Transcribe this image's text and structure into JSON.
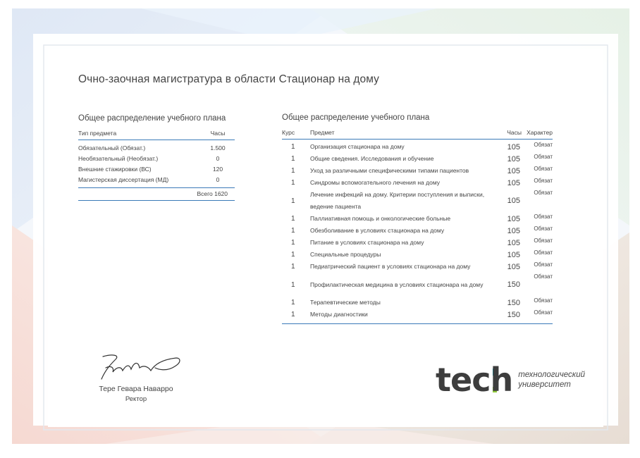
{
  "title": "Очно-заочная магистратура в области Стационар на дому",
  "summary_table": {
    "heading": "Общее распределение учебного плана",
    "col_type": "Тип предмета",
    "col_hours": "Часы",
    "rows": [
      {
        "type": "Обязательный (Обязат.)",
        "hours": "1.500"
      },
      {
        "type": "Необязательный (Необязат.)",
        "hours": "0"
      },
      {
        "type": "Внешние стажировки (ВС)",
        "hours": "120"
      },
      {
        "type": "Магистерская диссертация (МД)",
        "hours": "0"
      }
    ],
    "total": "Всего 1620"
  },
  "detail_table": {
    "heading": "Общее распределение учебного плана",
    "col_course": "Курс",
    "col_subject": "Предмет",
    "col_hours": "Часы",
    "col_type": "Характер",
    "rows": [
      {
        "course": "1",
        "subject": "Организация стационара на дому",
        "hours": "105",
        "type": "Обязат"
      },
      {
        "course": "1",
        "subject": "Общие сведения. Исследования и обучение",
        "hours": "105",
        "type": "Обязат"
      },
      {
        "course": "1",
        "subject": "Уход за различными специфическими типами пациентов",
        "hours": "105",
        "type": "Обязат"
      },
      {
        "course": "1",
        "subject": "Синдромы вспомогательного лечения на дому",
        "hours": "105",
        "type": "Обязат"
      },
      {
        "course": "1",
        "subject": "Лечение инфекций на дому. Критерии поступления и выписки, ведение пациента",
        "hours": "105",
        "type": "Обязат"
      },
      {
        "course": "1",
        "subject": "Паллиативная помощь и онкологические больные",
        "hours": "105",
        "type": "Обязат"
      },
      {
        "course": "1",
        "subject": "Обезболивание в условиях стационара на дому",
        "hours": "105",
        "type": "Обязат"
      },
      {
        "course": "1",
        "subject": "Питание в условиях стационара на дому",
        "hours": "105",
        "type": "Обязат"
      },
      {
        "course": "1",
        "subject": "Специальные процедуры",
        "hours": "105",
        "type": "Обязат"
      },
      {
        "course": "1",
        "subject": "Педиатрический пациент в условиях стационара на дому",
        "hours": "105",
        "type": "Обязат"
      },
      {
        "course": "1",
        "subject": "Профилактическая медицина в условиях стационара на дому",
        "hours": "150",
        "type": "Обязат"
      },
      {
        "course": "1",
        "subject": "Терапевтические методы",
        "hours": "150",
        "type": "Обязат"
      },
      {
        "course": "1",
        "subject": "Методы диагностики",
        "hours": "150",
        "type": "Обязат"
      }
    ]
  },
  "signatory": {
    "name": "Тере Гевара Наварро",
    "role": "Ректор"
  },
  "logo": {
    "word": "tech",
    "line1": "технологический",
    "line2": "университет",
    "accent_color": "#00b0c7",
    "accent_color_2": "#8fc93a"
  }
}
